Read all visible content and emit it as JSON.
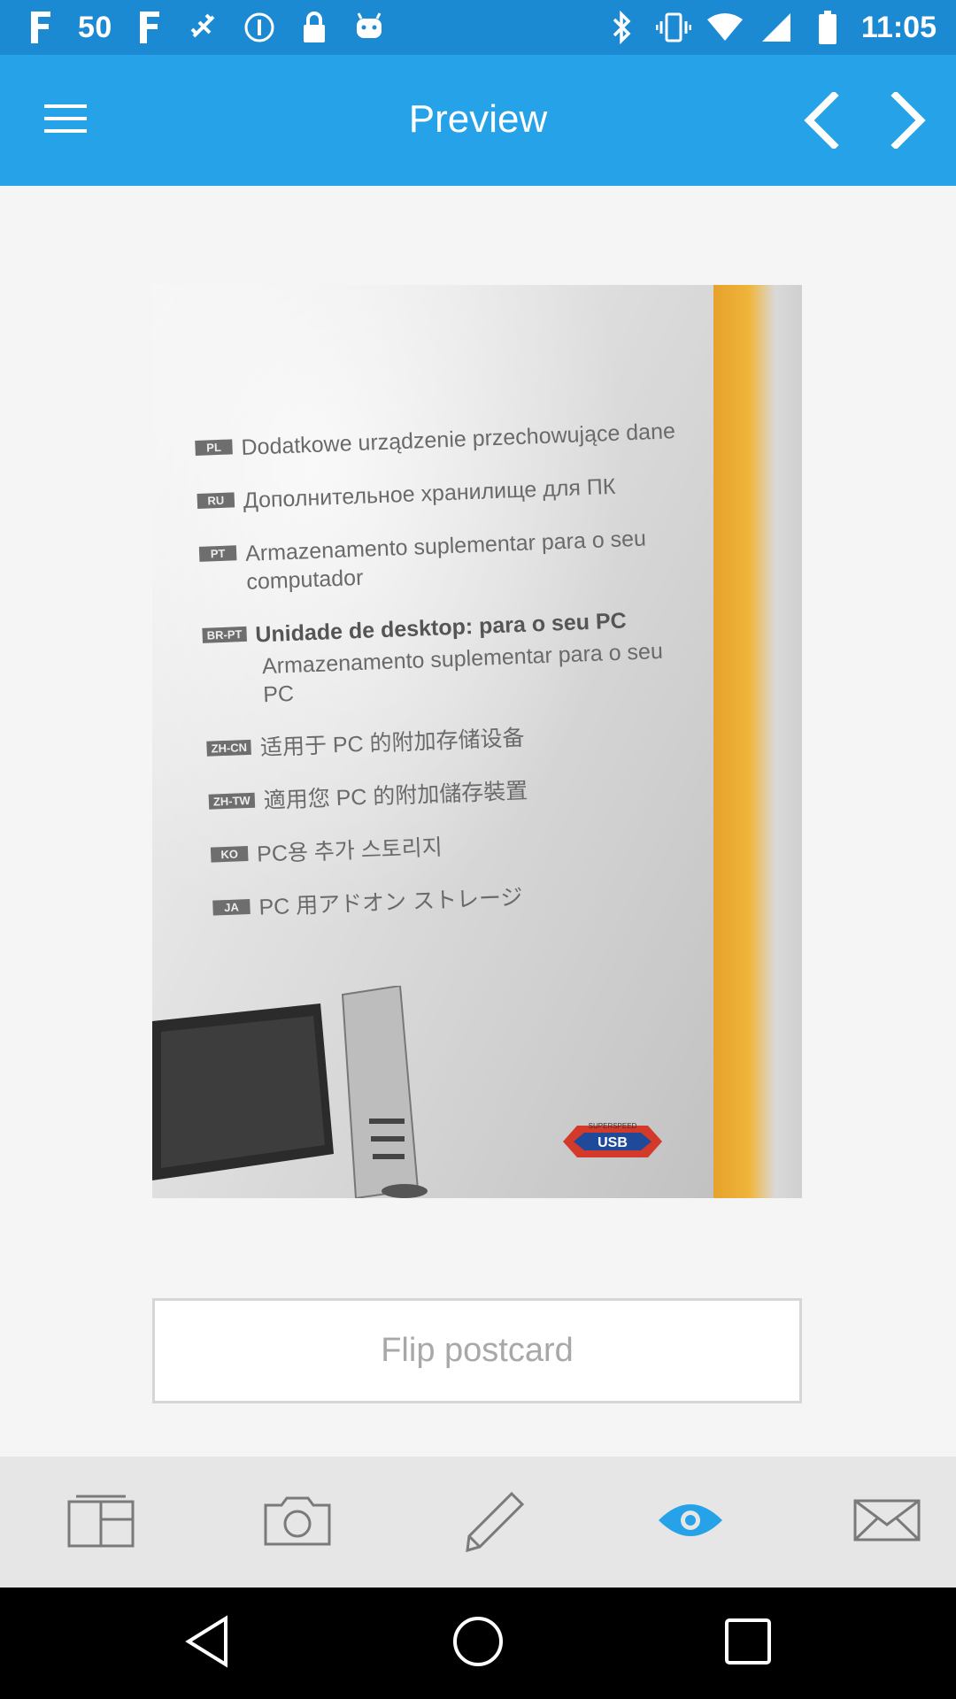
{
  "status_bar": {
    "left_icons": [
      "facebook-icon",
      "fifty-label",
      "facebook-icon",
      "fake-gps-icon",
      "info-circle-icon",
      "lock-icon",
      "android-icon"
    ],
    "network_text": "50",
    "time": "11:05",
    "right_icons": [
      "bluetooth-icon",
      "vibrate-icon",
      "wifi-icon",
      "signal-icon",
      "battery-icon"
    ]
  },
  "toolbar": {
    "title": "Preview",
    "menu_icon": "hamburger-menu-icon",
    "prev_icon": "chevron-left-icon",
    "next_icon": "chevron-right-icon"
  },
  "preview": {
    "lines": [
      {
        "tag": "PL",
        "text": "Dodatkowe urządzenie przechowujące dane",
        "bold": false
      },
      {
        "tag": "RU",
        "text": "Дополнительное хранилище для ПК",
        "bold": false
      },
      {
        "tag": "PT",
        "text": "Armazenamento suplementar para o seu computador",
        "bold": false
      },
      {
        "tag": "BR-PT",
        "text": "Unidade de desktop: para o seu PC",
        "bold": true
      },
      {
        "tag": "",
        "text": "Armazenamento suplementar para o seu PC",
        "bold": false
      },
      {
        "tag": "ZH-CN",
        "text": "适用于 PC 的附加存储设备",
        "bold": false
      },
      {
        "tag": "ZH-TW",
        "text": "適用您 PC 的附加儲存裝置",
        "bold": false
      },
      {
        "tag": "KO",
        "text": "PC용 추가 스토리지",
        "bold": false
      },
      {
        "tag": "JA",
        "text": "PC 用アドオン ストレージ",
        "bold": false
      }
    ],
    "usb_logo_top": "SUPERSPEED",
    "usb_logo_text": "USB"
  },
  "flip_button": {
    "label": "Flip postcard"
  },
  "bottom_nav": {
    "items": [
      "layout-icon",
      "camera-icon",
      "pencil-icon",
      "eye-icon",
      "envelope-icon"
    ],
    "active": "eye-icon",
    "active_color": "#26a2e9",
    "inactive_color": "#7a7a7a"
  },
  "android_nav": [
    "back-icon",
    "home-icon",
    "recents-icon"
  ],
  "colors": {
    "status_bar": "#1b8ad3",
    "toolbar": "#26a2e9"
  }
}
